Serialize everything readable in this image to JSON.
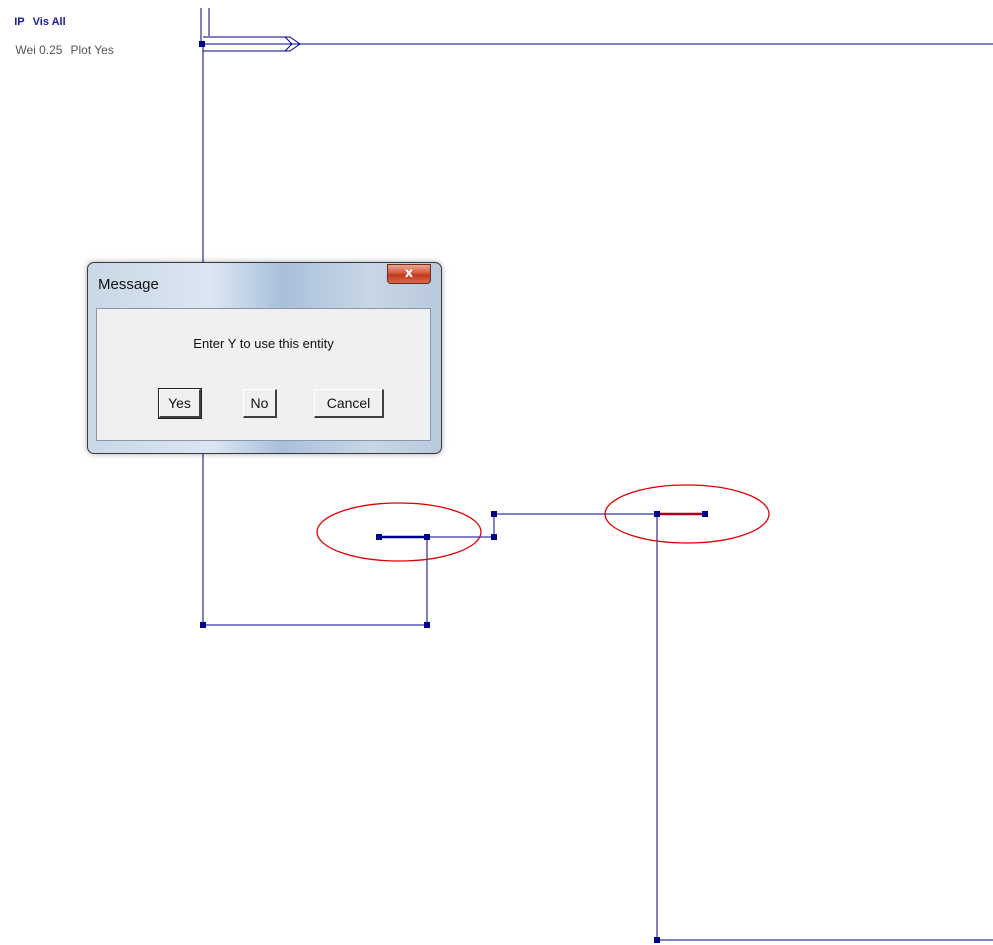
{
  "status": {
    "line1": [
      "IP",
      "Vis All"
    ],
    "line2": [
      "Wei 0.25",
      "Plot Yes"
    ]
  },
  "dialog": {
    "title": "Message",
    "close_label": "x",
    "message": "Enter Y to use this entity",
    "buttons": {
      "yes": "Yes",
      "no": "No",
      "cancel": "Cancel"
    }
  },
  "colors": {
    "entity_line": "#00008b",
    "highlight_line": "#b00020",
    "annotation_ellipse": "#e00000",
    "background": "#ffffff"
  }
}
